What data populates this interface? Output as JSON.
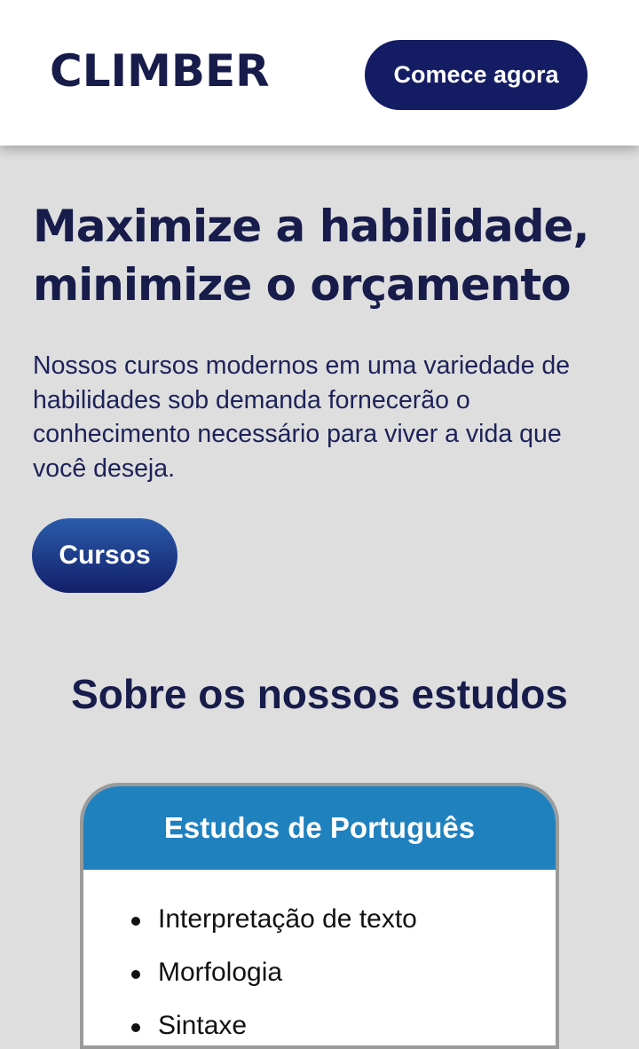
{
  "header": {
    "logo": "CLIMBER",
    "cta_label": "Comece agora"
  },
  "hero": {
    "title_line1": "Maximize a habilidade,",
    "title_line2": "minimize o orçamento",
    "text": "Nossos cursos modernos em uma variedade de habilidades sob demanda fornecerão o conhecimento necessário para viver a vida que você deseja.",
    "button_label": "Cursos"
  },
  "about": {
    "title": "Sobre os nossos estudos",
    "card": {
      "title": "Estudos de Português",
      "items": [
        "Interpretação de texto",
        "Morfologia",
        "Sintaxe"
      ]
    }
  },
  "colors": {
    "navy": "#171c4b",
    "button": "#141d64",
    "card_header": "#2081bf",
    "background": "#dededf"
  }
}
